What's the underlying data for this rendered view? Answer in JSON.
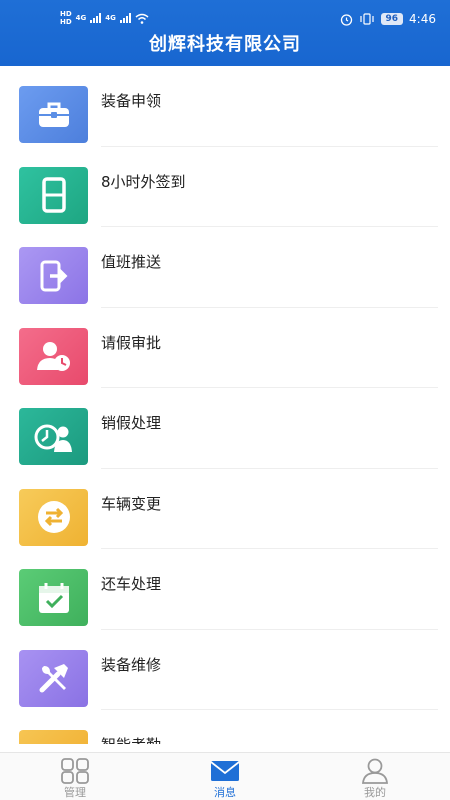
{
  "status": {
    "hd1": "HD",
    "hd2": "HD",
    "net1": "4G",
    "net2": "4G",
    "battery": "96",
    "time": "4:46"
  },
  "header": {
    "title": "创辉科技有限公司"
  },
  "menu": [
    {
      "label": "装备申领",
      "icon": "toolbox-icon",
      "color": "#5b8fe6"
    },
    {
      "label": "8小时外签到",
      "icon": "digit-eight-icon",
      "color": "#22b28f"
    },
    {
      "label": "值班推送",
      "icon": "phone-push-icon",
      "color": "#9b86ee"
    },
    {
      "label": "请假审批",
      "icon": "person-clock-icon",
      "color": "#ef5a7a"
    },
    {
      "label": "销假处理",
      "icon": "clock-person-icon",
      "color": "#22a48c"
    },
    {
      "label": "车辆变更",
      "icon": "swap-arrows-icon",
      "color": "#f3bf46"
    },
    {
      "label": "还车处理",
      "icon": "calendar-check-icon",
      "color": "#4cbf68"
    },
    {
      "label": "装备维修",
      "icon": "tools-icon",
      "color": "#9b82ec"
    },
    {
      "label": "智能考勤",
      "icon": "attendance-icon",
      "color": "#f4b93e"
    }
  ],
  "tabs": [
    {
      "label": "管理",
      "icon": "grid-icon",
      "active": false
    },
    {
      "label": "消息",
      "icon": "envelope-icon",
      "active": true
    },
    {
      "label": "我的",
      "icon": "user-icon",
      "active": false
    }
  ]
}
